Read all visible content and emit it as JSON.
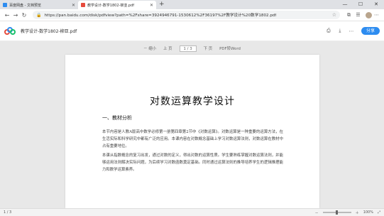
{
  "browser": {
    "tabs": [
      {
        "label": "百度网盘 - 文档预览",
        "active": false,
        "favicon_color": "#2d8cf0"
      },
      {
        "label": "教学设计-数学1802-柳亚.pdf",
        "active": true,
        "favicon_color": "#e64a3c"
      }
    ],
    "new_tab": "+",
    "url": "https://pan.baidu.com/disk/pdfview?path=%2Fshare=3924946791-1530612%2F36197%2F教学设计%20数学1802.pdf",
    "window_controls": [
      "—",
      "☐",
      "✕"
    ]
  },
  "app": {
    "file_name": "教学设计-数学1802-柳亚.pdf",
    "share_label": "分享"
  },
  "viewer": {
    "zoom_out": "－ 缩小",
    "page_indicator": "1 / 3",
    "prev": "上 页",
    "next": "下 页",
    "mode": "PDF转Word"
  },
  "document": {
    "title": "对数运算教学设计",
    "section": "一、教材分析",
    "para1": "本节内容是人教A版高中数学必修第一册第四章第2节中《对数运算》。对数运算是一种重要的运算方法，在生活实际和科学研究中都有广泛的应用。本课内容在对数概念基础上学习对数运算法则，对数运算在教材中占有重要地位。",
    "para2": "本课从指数概念的复习出发，通过对数的定义，得出对数的运算性质。学生要熟练掌握对数运算法则，并能够运用法则解决实际问题，为后续学习对数函数奠定基础。同时通过运算法则的推导培养学生的逻辑推理能力和数学运算素养。"
  },
  "status": {
    "page": "1 / 3",
    "zoom": "100%"
  }
}
